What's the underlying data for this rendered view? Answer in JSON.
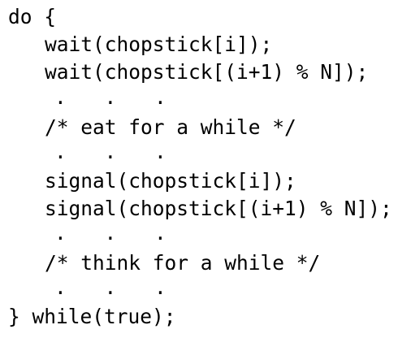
{
  "code": {
    "lines": [
      "do {",
      "wait(chopstick[i]);",
      "wait(chopstick[(i+1) % N]);",
      ". . .",
      "/* eat for a while */",
      ". . .",
      "signal(chopstick[i]);",
      "signal(chopstick[(i+1) % N]);",
      ". . .",
      "/* think for a while */",
      ". . .",
      "} while(true);"
    ]
  }
}
